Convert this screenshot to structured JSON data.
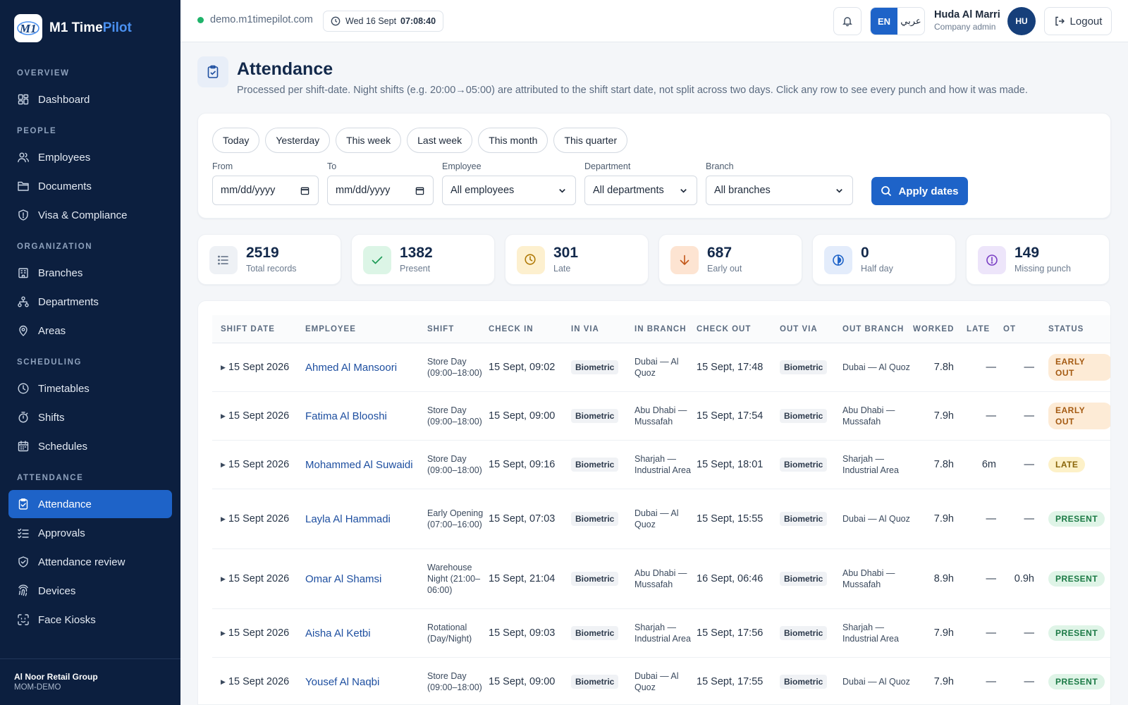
{
  "brand": {
    "name_main": "M1 Time",
    "name_accent": "Pilot",
    "logo_text": "M1"
  },
  "sidebar": {
    "sections": [
      {
        "title": "OVERVIEW",
        "items": [
          {
            "label": "Dashboard",
            "icon": "dashboard-icon"
          }
        ]
      },
      {
        "title": "PEOPLE",
        "items": [
          {
            "label": "Employees",
            "icon": "users-icon"
          },
          {
            "label": "Documents",
            "icon": "folder-icon"
          },
          {
            "label": "Visa & Compliance",
            "icon": "shield-icon"
          }
        ]
      },
      {
        "title": "ORGANIZATION",
        "items": [
          {
            "label": "Branches",
            "icon": "building-icon"
          },
          {
            "label": "Departments",
            "icon": "hierarchy-icon"
          },
          {
            "label": "Areas",
            "icon": "map-pin-icon"
          }
        ]
      },
      {
        "title": "SCHEDULING",
        "items": [
          {
            "label": "Timetables",
            "icon": "clock-icon"
          },
          {
            "label": "Shifts",
            "icon": "stopwatch-icon"
          },
          {
            "label": "Schedules",
            "icon": "calendar-icon"
          }
        ]
      },
      {
        "title": "ATTENDANCE",
        "items": [
          {
            "label": "Attendance",
            "icon": "clipboard-check-icon",
            "active": true
          },
          {
            "label": "Approvals",
            "icon": "checklist-icon"
          },
          {
            "label": "Attendance review",
            "icon": "shield-check-icon"
          },
          {
            "label": "Devices",
            "icon": "fingerprint-icon"
          },
          {
            "label": "Face Kiosks",
            "icon": "face-scan-icon"
          }
        ]
      }
    ],
    "footer": {
      "org_name": "Al Noor Retail Group",
      "org_code": "MOM-DEMO"
    }
  },
  "topbar": {
    "host": "demo.m1timepilot.com",
    "date": "Wed 16 Sept",
    "time": "07:08:40",
    "lang_en": "EN",
    "lang_ar": "عربي",
    "user_name": "Huda Al Marri",
    "user_role": "Company admin",
    "avatar_initials": "HU",
    "logout_label": "Logout"
  },
  "page": {
    "title": "Attendance",
    "subtitle": "Processed per shift-date. Night shifts (e.g. 20:00→05:00) are attributed to the shift start date, not split across two days. Click any row to see every punch and how it was made."
  },
  "filters": {
    "chips": [
      "Today",
      "Yesterday",
      "This week",
      "Last week",
      "This month",
      "This quarter"
    ],
    "from_label": "From",
    "from_placeholder": "mm/dd/yyyy",
    "to_label": "To",
    "to_placeholder": "mm/dd/yyyy",
    "employee_label": "Employee",
    "employee_value": "All employees",
    "department_label": "Department",
    "department_value": "All departments",
    "branch_label": "Branch",
    "branch_value": "All branches",
    "apply_label": "Apply dates"
  },
  "stats": [
    {
      "value": "2519",
      "label": "Total records",
      "icon": "list-icon",
      "bg": "#eef1f5",
      "fg": "#5b6b80"
    },
    {
      "value": "1382",
      "label": "Present",
      "icon": "check-icon",
      "bg": "#dcf5e6",
      "fg": "#1b9a55"
    },
    {
      "value": "301",
      "label": "Late",
      "icon": "clock-icon",
      "bg": "#fdf0cf",
      "fg": "#b07a08"
    },
    {
      "value": "687",
      "label": "Early out",
      "icon": "arrow-down-icon",
      "bg": "#fde4d2",
      "fg": "#c2571a"
    },
    {
      "value": "0",
      "label": "Half day",
      "icon": "half-circle-icon",
      "bg": "#e3ecfb",
      "fg": "#1e63c8"
    },
    {
      "value": "149",
      "label": "Missing punch",
      "icon": "alert-circle-icon",
      "bg": "#ede5fa",
      "fg": "#7a3fc4"
    }
  ],
  "table": {
    "headers": [
      "SHIFT DATE",
      "EMPLOYEE",
      "SHIFT",
      "CHECK IN",
      "IN VIA",
      "IN BRANCH",
      "CHECK OUT",
      "OUT VIA",
      "OUT BRANCH",
      "WORKED",
      "LATE",
      "OT",
      "STATUS"
    ],
    "rows": [
      {
        "date": "15 Sept 2026",
        "employee": "Ahmed Al Mansoori",
        "shift": "Store Day (09:00–18:00)",
        "check_in": "15 Sept, 09:02",
        "in_via": "Biometric",
        "in_branch": "Dubai — Al Quoz",
        "check_out": "15 Sept, 17:48",
        "out_via": "Biometric",
        "out_branch": "Dubai — Al Quoz",
        "worked": "7.8h",
        "late": "—",
        "ot": "—",
        "status": "EARLY OUT",
        "status_kind": "early"
      },
      {
        "date": "15 Sept 2026",
        "employee": "Fatima Al Blooshi",
        "shift": "Store Day (09:00–18:00)",
        "check_in": "15 Sept, 09:00",
        "in_via": "Biometric",
        "in_branch": "Abu Dhabi — Mussafah",
        "check_out": "15 Sept, 17:54",
        "out_via": "Biometric",
        "out_branch": "Abu Dhabi — Mussafah",
        "worked": "7.9h",
        "late": "—",
        "ot": "—",
        "status": "EARLY OUT",
        "status_kind": "early"
      },
      {
        "date": "15 Sept 2026",
        "employee": "Mohammed Al Suwaidi",
        "shift": "Store Day (09:00–18:00)",
        "check_in": "15 Sept, 09:16",
        "in_via": "Biometric",
        "in_branch": "Sharjah — Industrial Area",
        "check_out": "15 Sept, 18:01",
        "out_via": "Biometric",
        "out_branch": "Sharjah — Industrial Area",
        "worked": "7.8h",
        "late": "6m",
        "ot": "—",
        "status": "LATE",
        "status_kind": "late"
      },
      {
        "date": "15 Sept 2026",
        "employee": "Layla Al Hammadi",
        "shift": "Early Opening (07:00–16:00)",
        "check_in": "15 Sept, 07:03",
        "in_via": "Biometric",
        "in_branch": "Dubai — Al Quoz",
        "check_out": "15 Sept, 15:55",
        "out_via": "Biometric",
        "out_branch": "Dubai — Al Quoz",
        "worked": "7.9h",
        "late": "—",
        "ot": "—",
        "status": "PRESENT",
        "status_kind": "present"
      },
      {
        "date": "15 Sept 2026",
        "employee": "Omar Al Shamsi",
        "shift": "Warehouse Night (21:00–06:00)",
        "check_in": "15 Sept, 21:04",
        "in_via": "Biometric",
        "in_branch": "Abu Dhabi — Mussafah",
        "check_out": "16 Sept, 06:46",
        "out_via": "Biometric",
        "out_branch": "Abu Dhabi — Mussafah",
        "worked": "8.9h",
        "late": "—",
        "ot": "0.9h",
        "status": "PRESENT",
        "status_kind": "present"
      },
      {
        "date": "15 Sept 2026",
        "employee": "Aisha Al Ketbi",
        "shift": "Rotational (Day/Night)",
        "check_in": "15 Sept, 09:03",
        "in_via": "Biometric",
        "in_branch": "Sharjah — Industrial Area",
        "check_out": "15 Sept, 17:56",
        "out_via": "Biometric",
        "out_branch": "Sharjah — Industrial Area",
        "worked": "7.9h",
        "late": "—",
        "ot": "—",
        "status": "PRESENT",
        "status_kind": "present"
      },
      {
        "date": "15 Sept 2026",
        "employee": "Yousef Al Naqbi",
        "shift": "Store Day (09:00–18:00)",
        "check_in": "15 Sept, 09:00",
        "in_via": "Biometric",
        "in_branch": "Dubai — Al Quoz",
        "check_out": "15 Sept, 17:55",
        "out_via": "Biometric",
        "out_branch": "Dubai — Al Quoz",
        "worked": "7.9h",
        "late": "—",
        "ot": "—",
        "status": "PRESENT",
        "status_kind": "present"
      }
    ]
  }
}
